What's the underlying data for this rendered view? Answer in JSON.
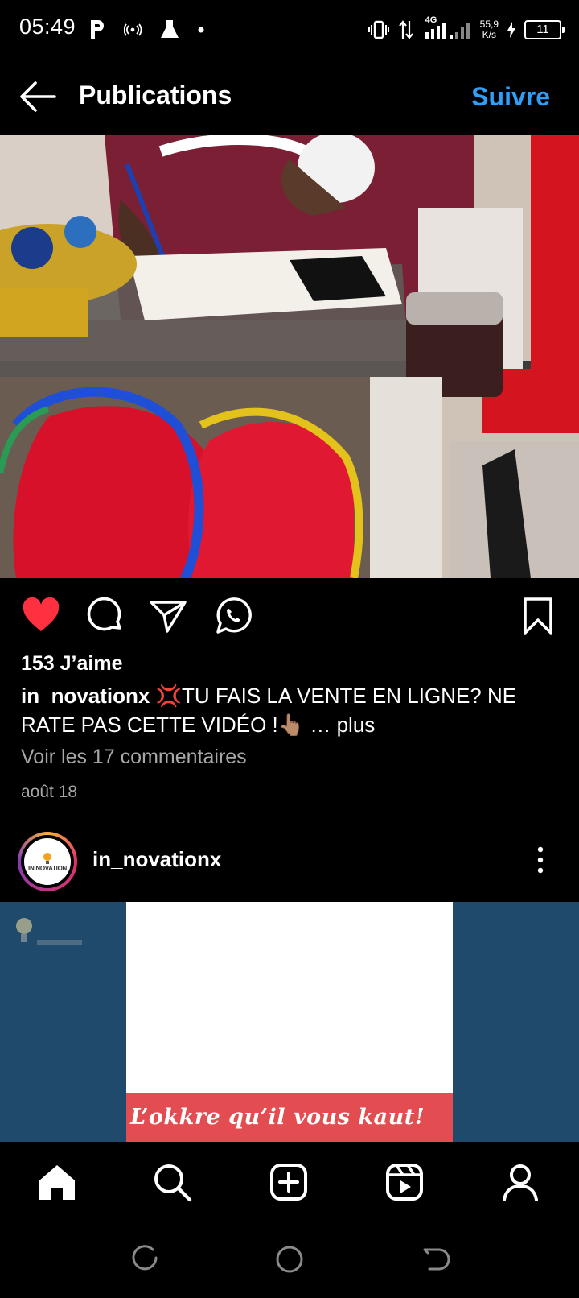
{
  "status_bar": {
    "time": "05:49",
    "net_type": "4G",
    "speed_value": "55,9",
    "speed_unit": "K/s",
    "battery": "11"
  },
  "header": {
    "title": "Publications",
    "follow_label": "Suivre",
    "follow_color": "#2f9ff8"
  },
  "post1": {
    "likes": "153 J’aime",
    "username": "in_novationx",
    "caption_text": "💢TU FAIS LA VENTE EN LIGNE? NE RATE PAS CETTE VIDÉO !👆🏽",
    "more_label": "… plus",
    "comments_link": "Voir les 17 commentaires",
    "date": "août 18",
    "liked": true,
    "like_color": "#ff3040"
  },
  "post2": {
    "username": "in_novationx",
    "avatar_text": "IN NOVATION",
    "media_text": "L’okkre qu’il vous kaut!"
  },
  "bottom_nav": {
    "items": [
      "home-icon",
      "search-icon",
      "create-icon",
      "reels-icon",
      "profile-icon"
    ]
  }
}
